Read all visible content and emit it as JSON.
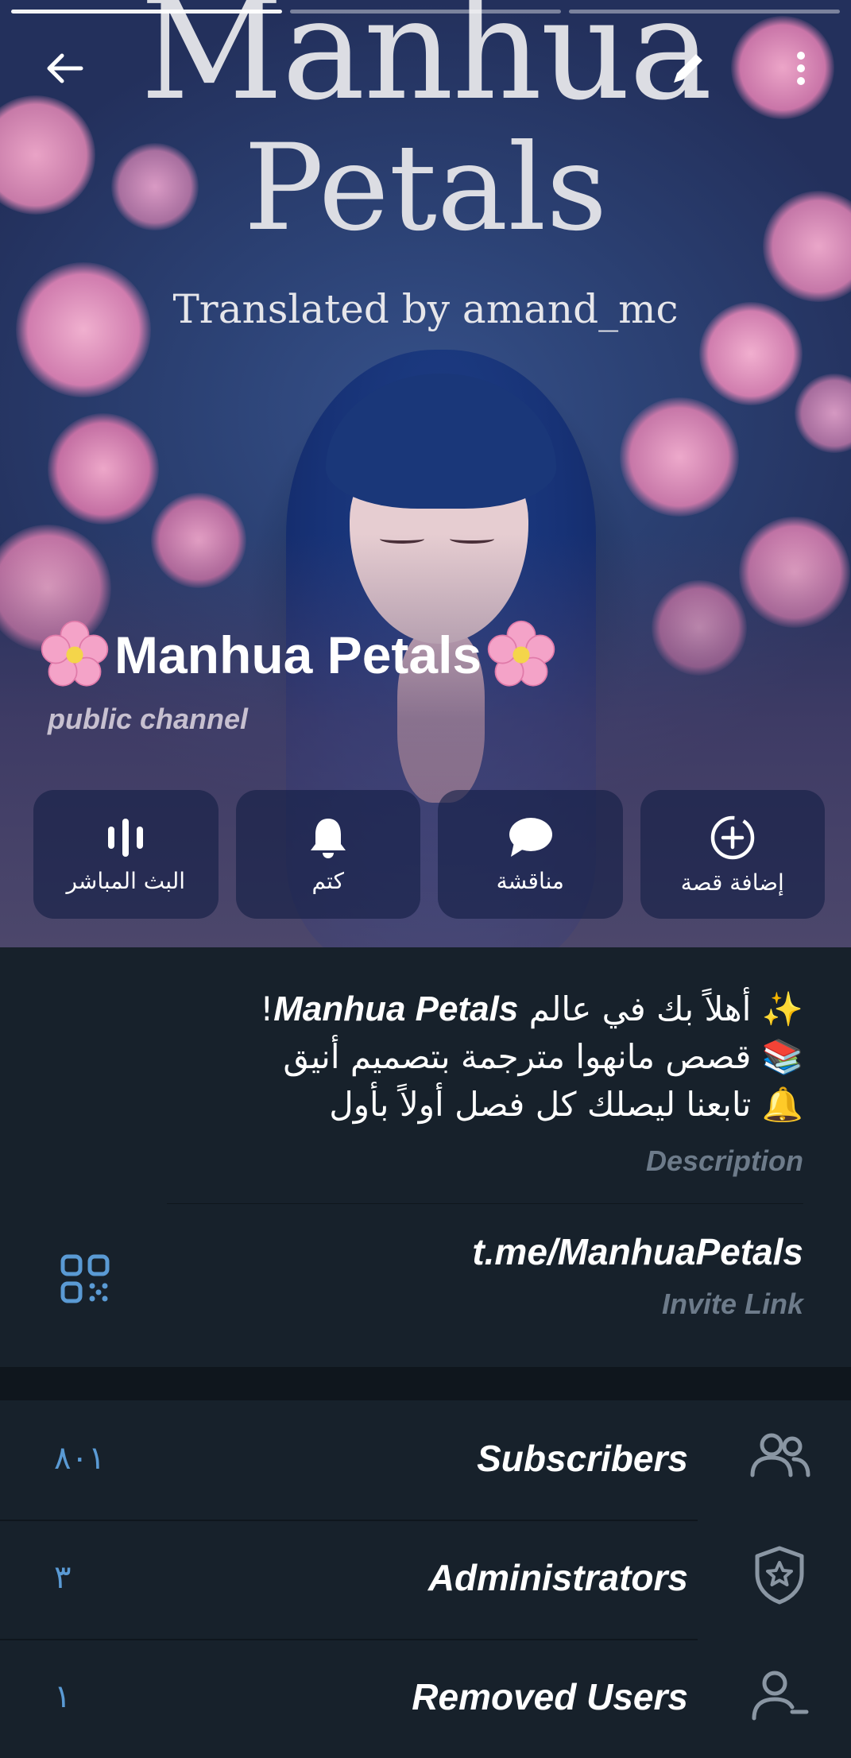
{
  "cover": {
    "line1": "Manhua",
    "line2": "Petals",
    "line3": "Translated by amand_mc"
  },
  "channel": {
    "title": "Manhua Petals",
    "subtitle": "public channel"
  },
  "actions": [
    {
      "label": "البث المباشر",
      "icon": "live-stream-icon"
    },
    {
      "label": "كتم",
      "icon": "bell-icon"
    },
    {
      "label": "مناقشة",
      "icon": "chat-bubble-icon"
    },
    {
      "label": "إضافة قصة",
      "icon": "add-story-icon"
    }
  ],
  "description": {
    "line1_prefix": "✨ أهلاً بك في عالم ",
    "line1_bold": "Manhua Petals",
    "line1_suffix": "!",
    "line2": "📚 قصص مانهوا مترجمة بتصميم أنيق",
    "line3": "🔔 تابعنا ليصلك كل فصل أولاً بأول",
    "label": "Description"
  },
  "invite": {
    "link": "t.me/ManhuaPetals",
    "label": "Invite Link"
  },
  "list": [
    {
      "title": "Subscribers",
      "count": "٨٠١",
      "icon": "people-icon"
    },
    {
      "title": "Administrators",
      "count": "٣",
      "icon": "shield-star-icon"
    },
    {
      "title": "Removed Users",
      "count": "١",
      "icon": "remove-user-icon"
    }
  ],
  "colors": {
    "background": "#17212b",
    "accent": "#5a9ad4",
    "label_gray": "#6d7b8a"
  }
}
